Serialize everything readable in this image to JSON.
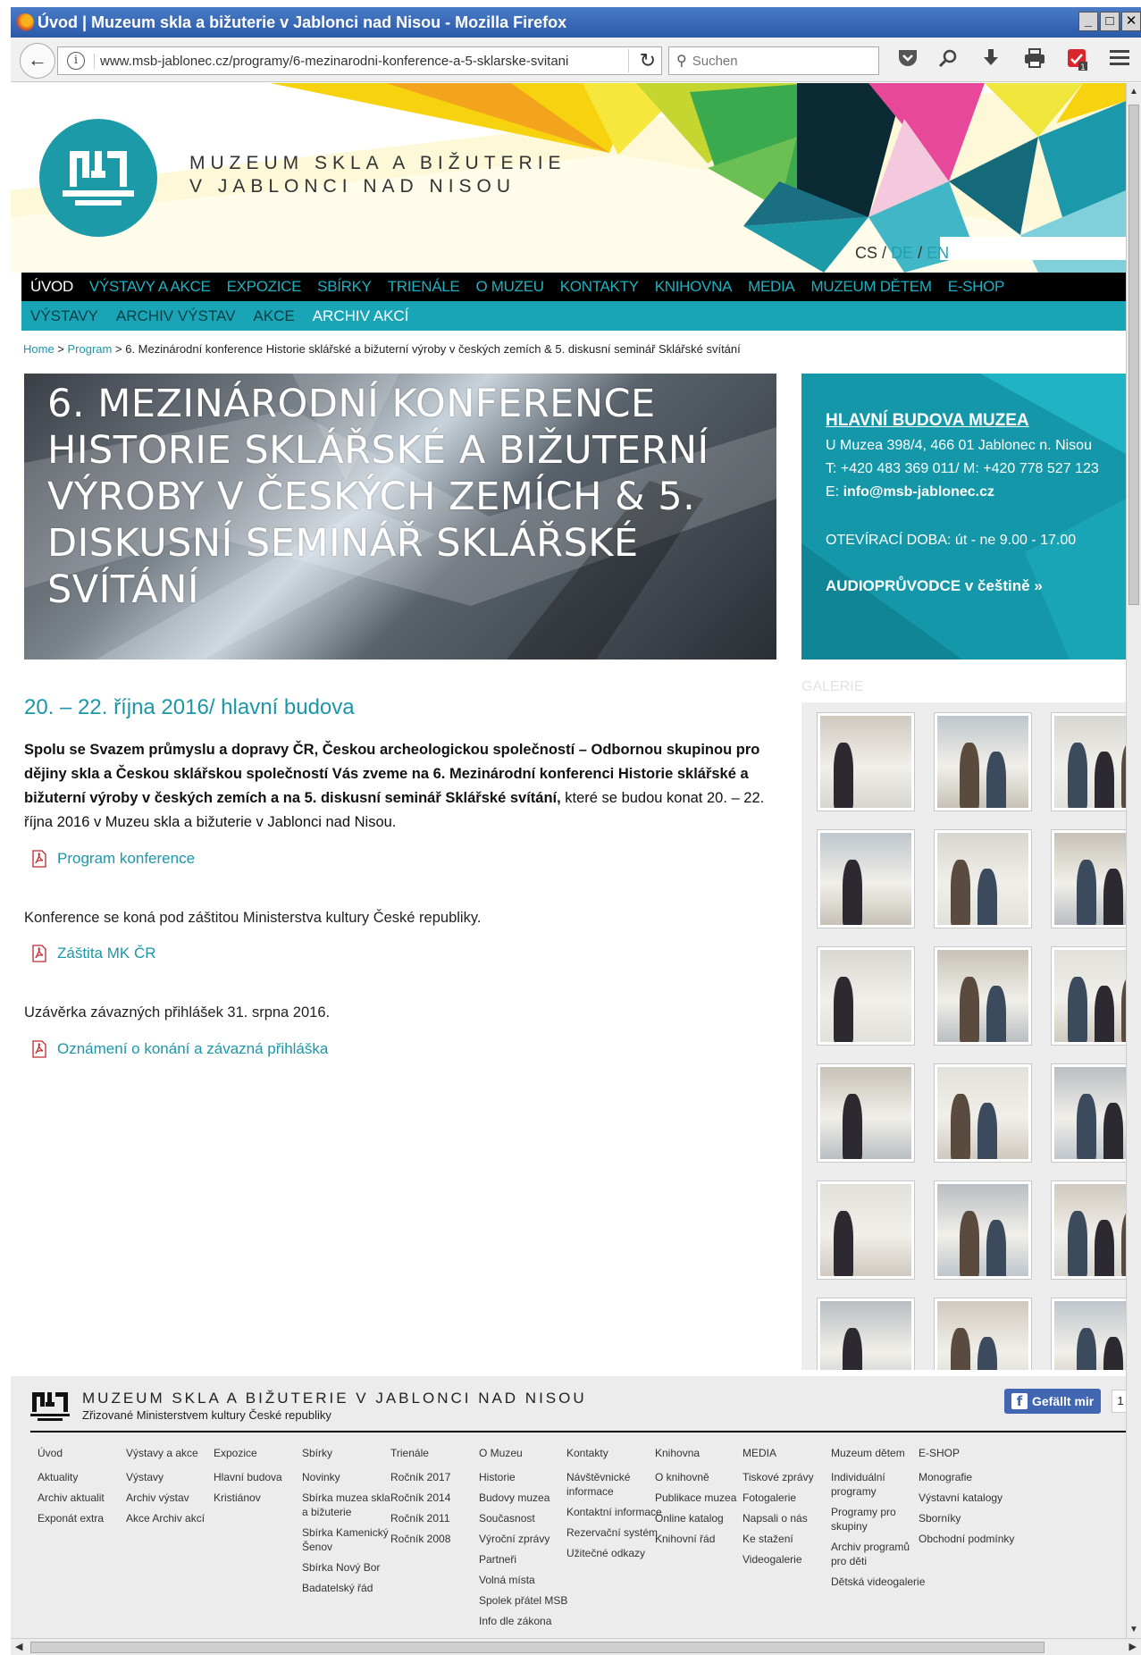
{
  "window": {
    "title": "Úvod | Muzeum skla a bižuterie v Jablonci nad Nisou - Mozilla Firefox"
  },
  "browser": {
    "url": "www.msb-jablonec.cz/programy/6-mezinarodni-konference-a-5-sklarske-svitani",
    "search_placeholder": "Suchen",
    "download_badge": "1"
  },
  "site": {
    "name_line1": "MUZEUM SKLA A BIŽUTERIE",
    "name_line2": "V JABLONCI NAD NISOU",
    "lang_cs": "CS",
    "lang_de": "DE",
    "lang_en": "EN",
    "lang_sep": "/"
  },
  "menu": [
    {
      "label": "ÚVOD",
      "active": true
    },
    {
      "label": "VÝSTAVY A AKCE",
      "active": false
    },
    {
      "label": "EXPOZICE",
      "active": false
    },
    {
      "label": "SBÍRKY",
      "active": false
    },
    {
      "label": "TRIENÁLE",
      "active": false
    },
    {
      "label": "O MUZEU",
      "active": false
    },
    {
      "label": "KONTAKTY",
      "active": false
    },
    {
      "label": "KNIHOVNA",
      "active": false
    },
    {
      "label": "MEDIA",
      "active": false
    },
    {
      "label": "MUZEUM DĚTEM",
      "active": false
    },
    {
      "label": "E-SHOP",
      "active": false
    }
  ],
  "submenu": [
    {
      "label": "VÝSTAVY",
      "active": false
    },
    {
      "label": "ARCHIV VÝSTAV",
      "active": false
    },
    {
      "label": "AKCE",
      "active": false
    },
    {
      "label": "ARCHIV AKCÍ",
      "active": true
    }
  ],
  "breadcrumb": {
    "home": "Home",
    "sep": " > ",
    "program": "Program",
    "current": "6. Mezinárodní konference Historie sklářské a bižuterní výroby v českých zemích & 5. diskusní seminář Sklářské svítání"
  },
  "hero": {
    "title": "6. MEZINÁRODNÍ KONFERENCE HISTORIE SKLÁŘSKÉ A BIŽUTERNÍ VÝROBY V ČESKÝCH ZEMÍCH & 5. DISKUSNÍ SEMINÁŘ SKLÁŘSKÉ SVÍTÁNÍ"
  },
  "infobox": {
    "title": "HLAVNÍ BUDOVA MUZEA",
    "address": "U Muzea 398/4, 466 01 Jablonec n. Nisou",
    "phone": "T: +420 483 369 011/ M: +420 778 527 123",
    "email_label": "E:",
    "email": "info@msb-jablonec.cz",
    "hours": "OTEVÍRACÍ DOBA: út - ne 9.00 - 17.00",
    "audio": "AUDIOPRŮVODCE v češtině »"
  },
  "content": {
    "date": "20. – 22. října 2016/ hlavní budova",
    "intro_bold": "Spolu se Svazem průmyslu a dopravy ČR, Českou archeologickou společností – Odbornou skupinou pro dějiny skla a Českou sklářskou společností Vás zveme na 6. Mezinárodní konferenci Historie sklářské a bižuterní výroby v českých zemích a na 5. diskusní seminář Sklářské svítání,",
    "intro_rest": " které se budou konat 20. – 22. října 2016 v Muzeu skla a bižuterie v Jablonci nad Nisou.",
    "link1": "Program konference",
    "para2": "Konference se koná pod záštitou Ministerstva kultury České republiky.",
    "link2": "Záštita MK ČR",
    "para3": "Uzávěrka závazných přihlášek 31. srpna 2016.",
    "link3": "Oznámení o konání a závazná přihláška"
  },
  "gallery": {
    "label": "GALERIE"
  },
  "footer": {
    "name": "MUZEUM SKLA A BIŽUTERIE V JABLONCI NAD NISOU",
    "subtitle": "Zřizované Ministerstvem kultury České republiky",
    "fb_like": "Gefällt mir",
    "fb_count": "1",
    "columns": [
      {
        "head": "Úvod",
        "items": [
          "Aktuality",
          "Archiv aktualit",
          "Exponát extra"
        ]
      },
      {
        "head": "Výstavy a akce",
        "items": [
          "Výstavy",
          "Archiv výstav",
          "Akce Archiv akcí"
        ]
      },
      {
        "head": "Expozice",
        "items": [
          "Hlavní budova",
          "Kristiánov"
        ]
      },
      {
        "head": "Sbírky",
        "items": [
          "Novinky",
          "Sbírka muzea skla a bižuterie",
          "Sbírka Kamenický Šenov",
          "Sbírka Nový Bor",
          "Badatelský řád"
        ]
      },
      {
        "head": "Trienále",
        "items": [
          "Ročník 2017",
          "Ročník 2014",
          "Ročník 2011",
          "Ročník 2008"
        ]
      },
      {
        "head": "O Muzeu",
        "items": [
          "Historie",
          "Budovy muzea",
          "Současnost",
          "Výroční zprávy",
          "Partneři",
          "Volná místa",
          "Spolek přátel MSB",
          "Info dle zákona"
        ]
      },
      {
        "head": "Kontakty",
        "items": [
          "Návštěvnické informace",
          "Kontaktní informace",
          "Rezervační systém",
          "Užitečné odkazy"
        ]
      },
      {
        "head": "Knihovna",
        "items": [
          "O knihovně",
          "Publikace muzea",
          "Online katalog",
          "Knihovní řád"
        ]
      },
      {
        "head": "MEDIA",
        "items": [
          "Tiskové zprávy",
          "Fotogalerie",
          "Napsali o nás",
          "Ke stažení",
          "Videogalerie"
        ]
      },
      {
        "head": "Muzeum dětem",
        "items": [
          "Individuální programy",
          "Programy pro skupiny",
          "Archiv programů pro děti",
          "Dětská videogalerie"
        ]
      },
      {
        "head": "E-SHOP",
        "items": [
          "Monografie",
          "Výstavní katalogy",
          "Sborníky",
          "Obchodní podmínky"
        ]
      }
    ]
  },
  "colors": {
    "accent": "#1fa3b3",
    "teal_box": "#1497a8",
    "menu_bg": "#000000",
    "submenu_bg": "#1aa5b6"
  }
}
